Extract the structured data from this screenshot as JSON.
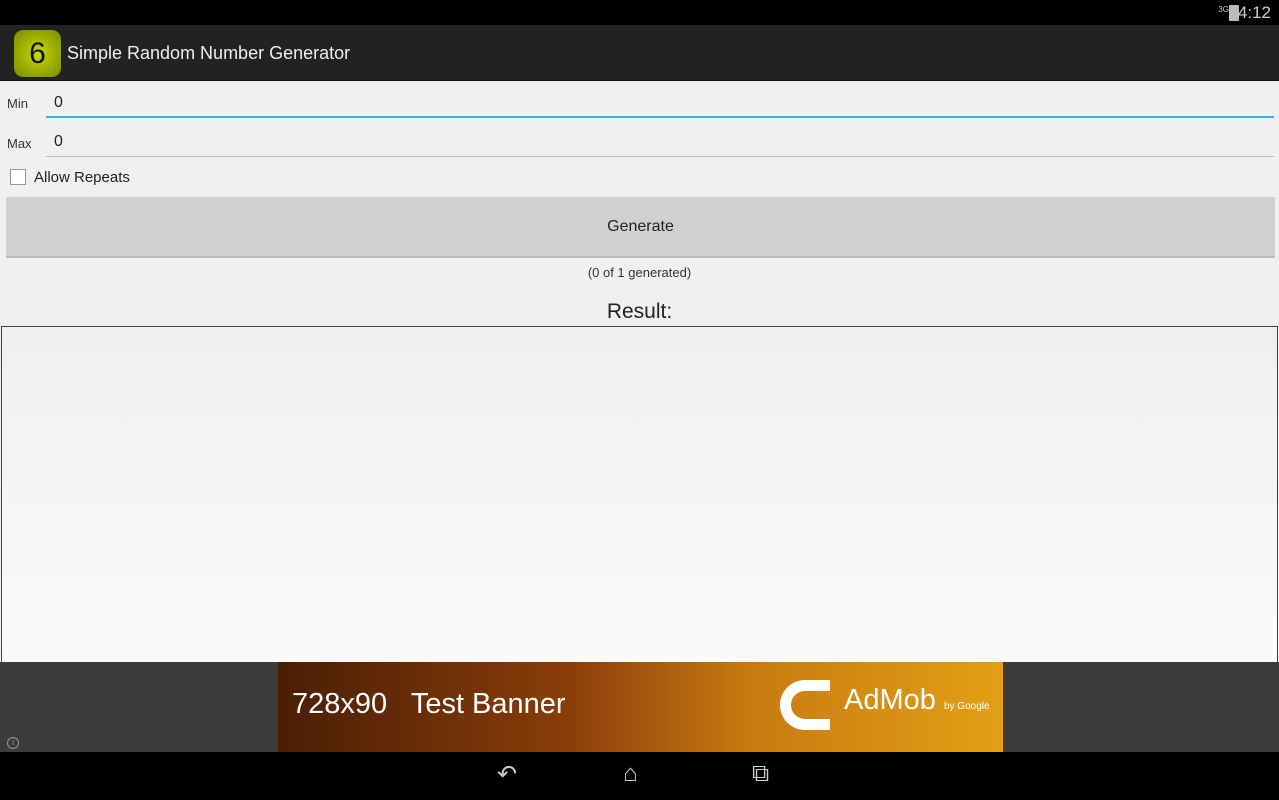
{
  "status": {
    "network": "3G",
    "time": "4:12"
  },
  "app": {
    "title": "Simple Random Number Generator",
    "logo_digit": "6"
  },
  "form": {
    "min_label": "Min",
    "min_value": "0",
    "max_label": "Max",
    "max_value": "0",
    "repeats_label": "Allow Repeats",
    "repeats_checked": false
  },
  "generate_label": "Generate",
  "count_text": "(0 of 1 generated)",
  "result_label": "Result:",
  "ad": {
    "size": "728x90",
    "text": "Test Banner",
    "brand": "AdMob",
    "by": "by Google",
    "info": "i"
  }
}
